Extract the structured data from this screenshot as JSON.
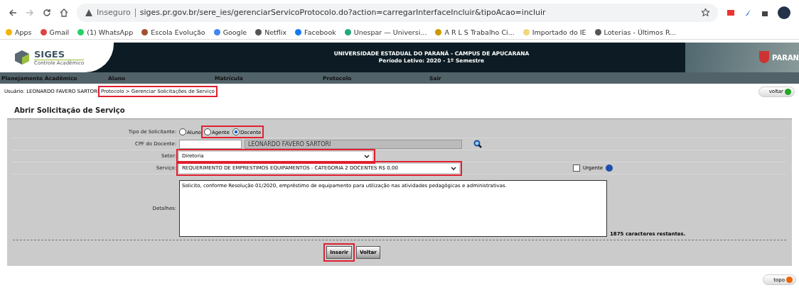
{
  "browser": {
    "security": "Inseguro",
    "url": "siges.pr.gov.br/sere_ies/gerenciarServicoProtocolo.do?action=carregarInterfaceIncluir&tipoAcao=incluir",
    "bookmarks": [
      "Apps",
      "Gmail",
      "(1) WhatsApp",
      "Escola Evolução",
      "Google",
      "Netflix",
      "Facebook",
      "Unespar — Universi...",
      "A R L S Trabalho Ci...",
      "Importado do IE",
      "Loterias - Últimos R..."
    ]
  },
  "header": {
    "logo_title": "SIGES",
    "logo_subtitle": "Controle Acadêmico",
    "university": "UNIVERSIDADE ESTADUAL DO PARANÁ - CAMPUS DE APUCARANA",
    "period": "Período Letivo: 2020 - 1º Semestre",
    "state_logo": "PARAN"
  },
  "menu": [
    "Planejamento Acadêmico",
    "Aluno",
    "Matrícula",
    "Protocolo",
    "Sair"
  ],
  "user": "Usuário: LEONARDO FAVERO SARTORI",
  "breadcrumb": {
    "text": "Protocolo > Gerenciar Solicitações de Serviço",
    "highlighted": true
  },
  "back_link": "voltar",
  "form": {
    "title": "Abrir Solicitação de Serviço",
    "requester": {
      "label": "Tipo de Solicitante:",
      "options": [
        {
          "label": "Aluno",
          "selected": false,
          "highlighted": false
        },
        {
          "label": "Agente",
          "selected": false,
          "highlighted": true
        },
        {
          "label": "Docente",
          "selected": true,
          "highlighted": true
        }
      ]
    },
    "cpf": {
      "label": "CPF do Docente:",
      "name": "LEONARDO FAVERO SARTORI"
    },
    "sector": {
      "label": "Setor:",
      "value": "Diretoria",
      "highlighted": true
    },
    "service": {
      "label": "Serviço:",
      "value": "REQUERIMENTO DE EMPRESTIMOS EQUIPAMENTOS - CATEGORIA 2 DOCENTES R$ 0,00",
      "highlighted": true
    },
    "urgent": {
      "label": "Urgente",
      "checked": false
    },
    "details": {
      "label": "Detalhes:",
      "value": "Solicito, conforme Resolução 01/2020, empréstimo de equipamento para utilização nas atividades pedagógicas e administrativas.",
      "remaining": "1875 caracteres restantes."
    },
    "buttons": [
      {
        "label": "Inserir",
        "highlighted": true
      },
      {
        "label": "Voltar"
      }
    ]
  },
  "top_link": "topo"
}
